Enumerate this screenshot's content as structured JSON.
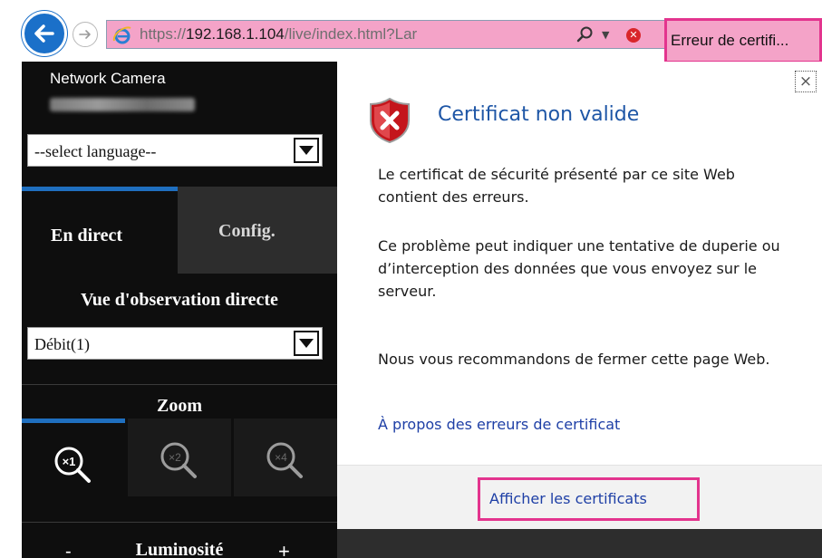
{
  "browser": {
    "url_prefix": "https://",
    "url_host": "192.168.1.104",
    "url_path": "/live/index.html?Lar",
    "cert_error_label": "Erreur de certifi..."
  },
  "sidebar": {
    "camera_title": "Network Camera",
    "language_select": "--select language--",
    "tab_live": "En direct",
    "tab_config": "Config.",
    "view_title": "Vue d'observation directe",
    "stream_select": "Débit(1)",
    "zoom_title": "Zoom",
    "zoom_buttons": [
      "×1",
      "×2",
      "×4"
    ],
    "luminosity_title": "Luminosité",
    "luminosity_minus": "-",
    "luminosity_plus": "+"
  },
  "popup": {
    "title": "Certificat non valide",
    "para1": "Le certificat de sécurité présenté par ce site Web contient des erreurs.",
    "para2": "Ce problème peut indiquer une tentative de duperie ou d’interception des données que vous envoyez sur le serveur.",
    "para3": "Nous vous recommandons de fermer cette page Web.",
    "link": "À propos des erreurs de certificat",
    "view_certificates": "Afficher les certificats",
    "close": "×"
  },
  "colors": {
    "accent": "#1f6fbf",
    "highlight": "#e3348e",
    "link": "#1e3fa6"
  }
}
